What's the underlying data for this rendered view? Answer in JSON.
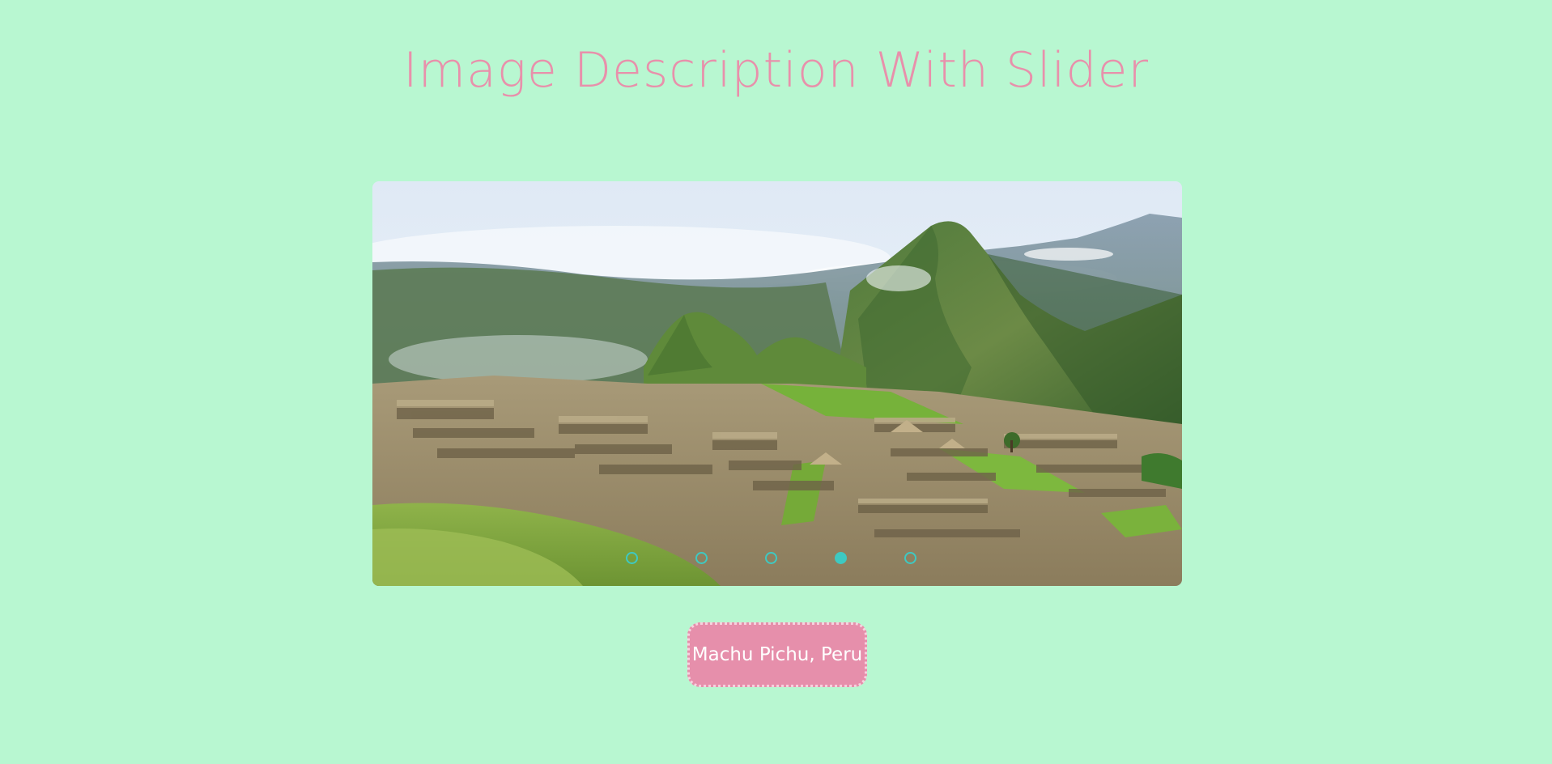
{
  "page": {
    "title": "Image Description With Slider",
    "background_color": "#b8f7d1",
    "title_color": "#e890ab"
  },
  "slider": {
    "current_slide_index": 3,
    "slide_count": 5,
    "slide_image_icon": "mountain-ruins-landscape",
    "caption": "Machu Pichu, Peru",
    "dot_color": "#3ec9c2",
    "caption_bg_color": "#e68fab"
  }
}
